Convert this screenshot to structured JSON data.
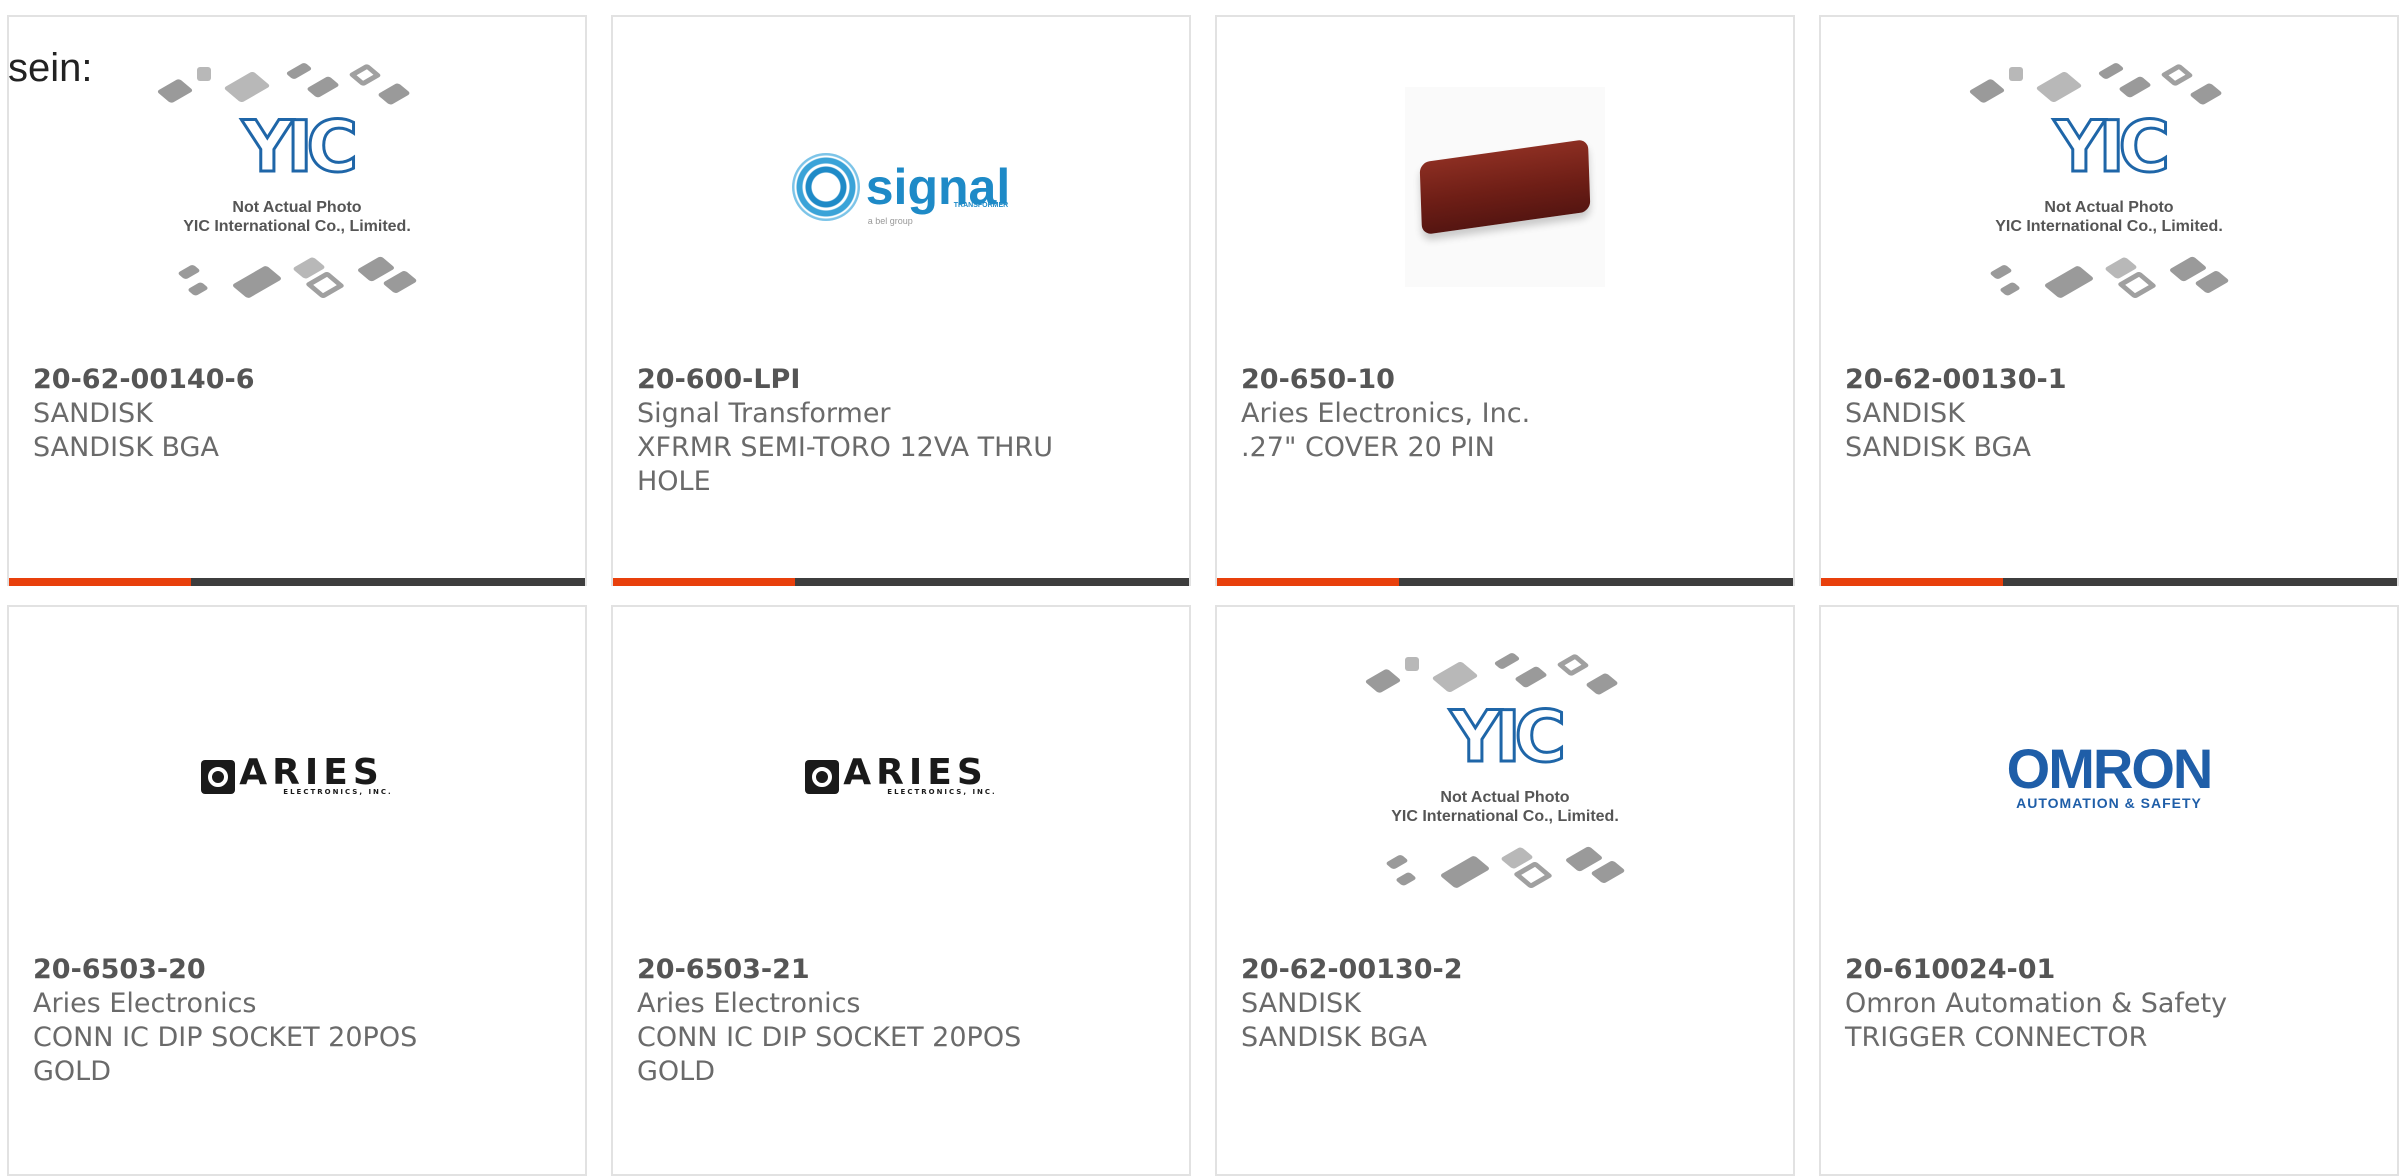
{
  "heading": "sein:",
  "placeholder": {
    "logo": "YIC",
    "caption_line1": "Not Actual Photo",
    "caption_line2": "YIC International Co., Limited."
  },
  "logos": {
    "signal": {
      "word": "signal",
      "sub": "TRANSFORMER",
      "tag": "a bel group"
    },
    "aries": {
      "word": "ARIES",
      "sub": "ELECTRONICS, INC."
    },
    "omron": {
      "word": "OMRON",
      "sub": "AUTOMATION & SAFETY"
    }
  },
  "colors": {
    "accent": "#e8400c",
    "bar": "#3d3d3d",
    "signal": "#1e8ac7",
    "omron": "#1f5ea8",
    "yic": "#1f66a8"
  },
  "products": [
    {
      "part_number": "20-62-00140-6",
      "manufacturer": "SANDISK",
      "description": "SANDISK BGA",
      "image": "yic-placeholder"
    },
    {
      "part_number": "20-600-LPI",
      "manufacturer": "Signal Transformer",
      "description": "XFRMR SEMI-TORO 12VA THRU HOLE",
      "image": "signal-logo"
    },
    {
      "part_number": "20-650-10",
      "manufacturer": "Aries Electronics, Inc.",
      "description": ".27\" COVER 20 PIN",
      "image": "product-photo"
    },
    {
      "part_number": "20-62-00130-1",
      "manufacturer": "SANDISK",
      "description": "SANDISK BGA",
      "image": "yic-placeholder"
    },
    {
      "part_number": "20-6503-20",
      "manufacturer": "Aries Electronics",
      "description": "CONN IC DIP SOCKET 20POS GOLD",
      "image": "aries-logo"
    },
    {
      "part_number": "20-6503-21",
      "manufacturer": "Aries Electronics",
      "description": "CONN IC DIP SOCKET 20POS GOLD",
      "image": "aries-logo"
    },
    {
      "part_number": "20-62-00130-2",
      "manufacturer": "SANDISK",
      "description": "SANDISK BGA",
      "image": "yic-placeholder"
    },
    {
      "part_number": "20-610024-01",
      "manufacturer": "Omron Automation & Safety",
      "description": "TRIGGER CONNECTOR",
      "image": "omron-logo"
    }
  ]
}
